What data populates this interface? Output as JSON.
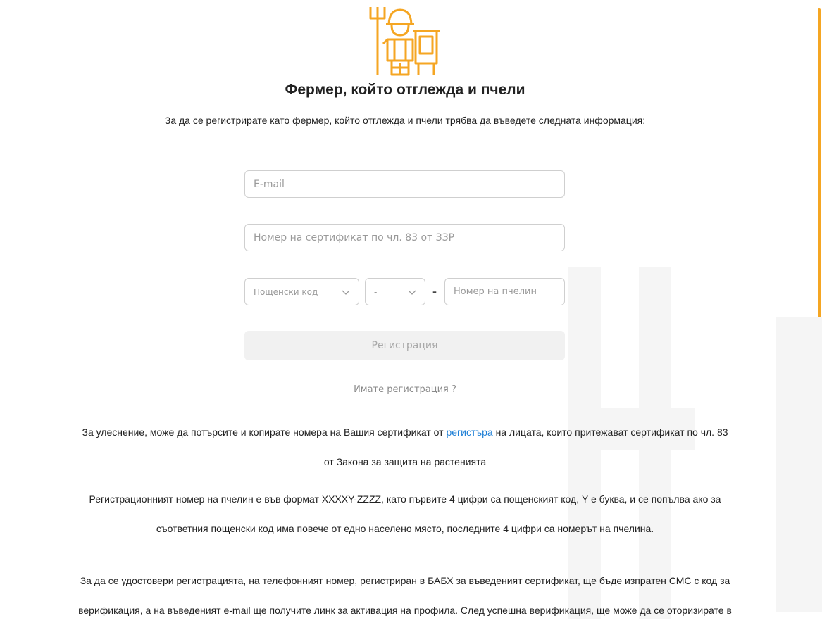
{
  "title": "Фермер, който отглежда и пчели",
  "intro": "За да се регистрирате като фермер, който отглежда и пчели трябва да въведете следната информация:",
  "form": {
    "email_placeholder": "E-mail",
    "certificate_placeholder": "Номер на сертификат по чл. 83 от ЗЗР",
    "postcode_selected": "Пощенски код",
    "suffix_selected": "-",
    "separator": "-",
    "apiary_placeholder": "Номер на пчелин",
    "register_label": "Регистрация",
    "login_link": "Имате регистрация ?"
  },
  "info": {
    "p1_line1_before": "За улеснение, може да потърсите и копирате номера на Вашия сертификат от ",
    "p1_link": "регистъра",
    "p1_line1_after": " на лицата, които притежават сертификат по чл. 83",
    "p1_line2": "от Закона за защита на растенията",
    "p2_line1": "Регистрационният номер на пчелин е във формат XXXXY-ZZZZ, като първите 4 цифри са пощенският код, Y е буква, и се попълва ако за",
    "p2_line2": "съответния пощенски код има повече от едно населено място, последните 4 цифри са номерът на пчелина.",
    "p3_line1": "За да се удостовери регистрацията, на телефонният номер, регистриран в БАБХ за въведеният сертификат, ще бъде изпратен СМС с код за",
    "p3_line2": "верификация, а на въведеният e-mail ще получите линк за активация на профила. След успешна верификация, ще може да се оторизирате в"
  },
  "colors": {
    "accent": "#f5a623",
    "link": "#1e7fd6"
  },
  "icons": {
    "logo": "farmer-with-pitchfork-icon",
    "chevron": "chevron-down-icon"
  }
}
